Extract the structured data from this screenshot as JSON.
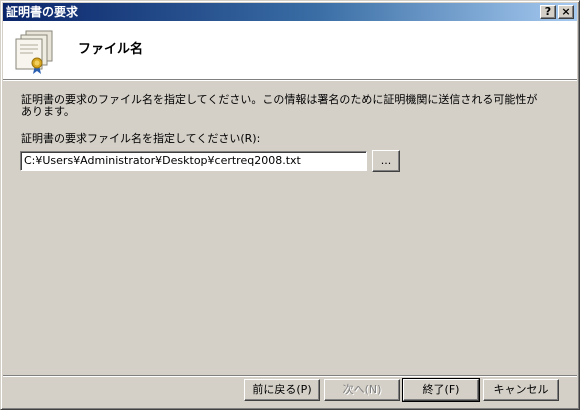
{
  "window": {
    "title": "証明書の要求",
    "help_label": "?",
    "close_label": "×"
  },
  "header": {
    "title": "ファイル名",
    "icon": "certificate-stack-icon"
  },
  "body": {
    "description": "証明書の要求のファイル名を指定してください。この情報は署名のために証明機関に送信される可能性があります。",
    "field_label": "証明書の要求ファイル名を指定してください(R):",
    "file_path": "C:¥Users¥Administrator¥Desktop¥certreq2008.txt",
    "browse_label": "..."
  },
  "footer": {
    "back_label": "前に戻る(P)",
    "next_label": "次へ(N)",
    "finish_label": "終了(F)",
    "cancel_label": "キャンセル"
  },
  "colors": {
    "title_gradient_start": "#0a246a",
    "title_gradient_end": "#a6caf0",
    "dialog_face": "#d4d0c8",
    "ribbon": "#2a5fb0",
    "seal": "#d9a820"
  }
}
